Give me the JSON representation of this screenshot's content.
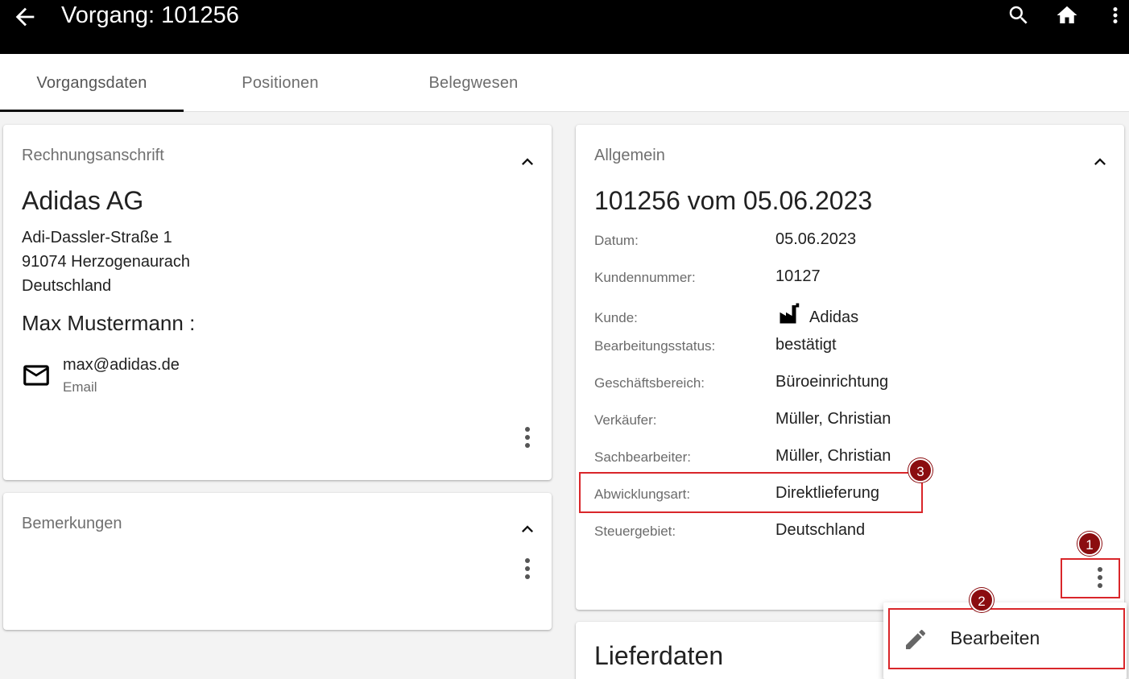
{
  "appbar": {
    "title": "Vorgang: 101256",
    "back_icon": "arrow-left-icon",
    "search_icon": "search-icon",
    "home_icon": "home-icon",
    "more_icon": "more-vert-icon"
  },
  "tabs": [
    {
      "label": "Vorgangsdaten",
      "active": true
    },
    {
      "label": "Positionen",
      "active": false
    },
    {
      "label": "Belegwesen",
      "active": false
    }
  ],
  "rechnung": {
    "title": "Rechnungsanschrift",
    "company": "Adidas AG",
    "street": "Adi-Dassler-Straße 1",
    "city": "91074 Herzogenaurach",
    "country": "Deutschland",
    "contact": "Max Mustermann :",
    "email": "max@adidas.de",
    "email_label": "Email"
  },
  "bemerkungen": {
    "title": "Bemerkungen"
  },
  "allgemein": {
    "title": "Allgemein",
    "heading": "101256 vom 05.06.2023",
    "rows": [
      {
        "label": "Datum:",
        "value": "05.06.2023"
      },
      {
        "label": "Kundennummer:",
        "value": "10127"
      },
      {
        "label": "Kunde:",
        "value": "Adidas"
      },
      {
        "label": "Bearbeitungsstatus:",
        "value": "bestätigt"
      },
      {
        "label": "Geschäftsbereich:",
        "value": "Büroeinrichtung"
      },
      {
        "label": "Verkäufer:",
        "value": "Müller, Christian"
      },
      {
        "label": "Sachbearbeiter:",
        "value": "Müller, Christian"
      },
      {
        "label": "Abwicklungsart:",
        "value": "Direktlieferung"
      },
      {
        "label": "Steuergebiet:",
        "value": "Deutschland"
      }
    ]
  },
  "lieferdaten": {
    "title": "Lieferdaten"
  },
  "menu": {
    "edit_label": "Bearbeiten"
  },
  "annotations": {
    "badge1": "1",
    "badge2": "2",
    "badge3": "3",
    "highlight_color": "#d9262a",
    "badge_color": "#8b0d10"
  }
}
